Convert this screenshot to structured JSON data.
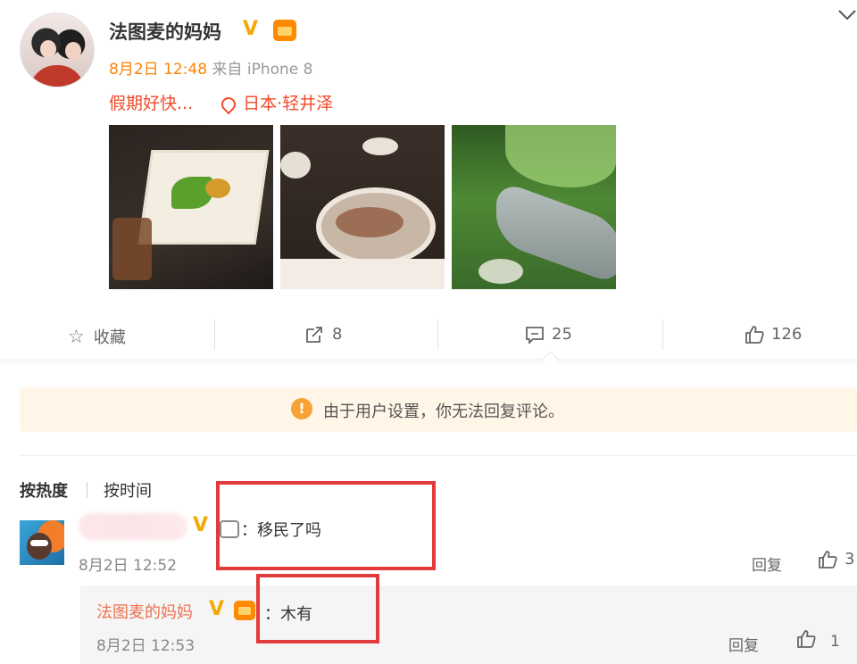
{
  "post": {
    "author": "法图麦的妈妈",
    "verified_badge": "V",
    "date": "8月2日 12:48",
    "source": "来自 iPhone 8",
    "text": "假期好快...",
    "location": "日本·轻井泽",
    "photos": [
      "photo-dessert",
      "photo-meal",
      "photo-forest-river"
    ]
  },
  "actions": {
    "favorite_label": "收藏",
    "repost_count": "8",
    "comment_count": "25",
    "like_count": "126"
  },
  "notice": {
    "icon": "!",
    "text": "由于用户设置，你无法回复评论。"
  },
  "sort": {
    "hot": "按热度",
    "time": "按时间"
  },
  "comments": [
    {
      "badge": "V",
      "text": "：移民了吗",
      "time": "8月2日 12:52",
      "reply_label": "回复",
      "like_count": "3",
      "replies": [
        {
          "author": "法图麦的妈妈",
          "badge": "V",
          "text": "：木有",
          "time": "8月2日 12:53",
          "reply_label": "回复",
          "like_count": "1"
        }
      ]
    }
  ],
  "colors": {
    "accent_orange": "#ff8200",
    "vip_gold": "#f4a800",
    "annotation_red": "#e23b3b",
    "notice_bg": "#fff6e8"
  }
}
